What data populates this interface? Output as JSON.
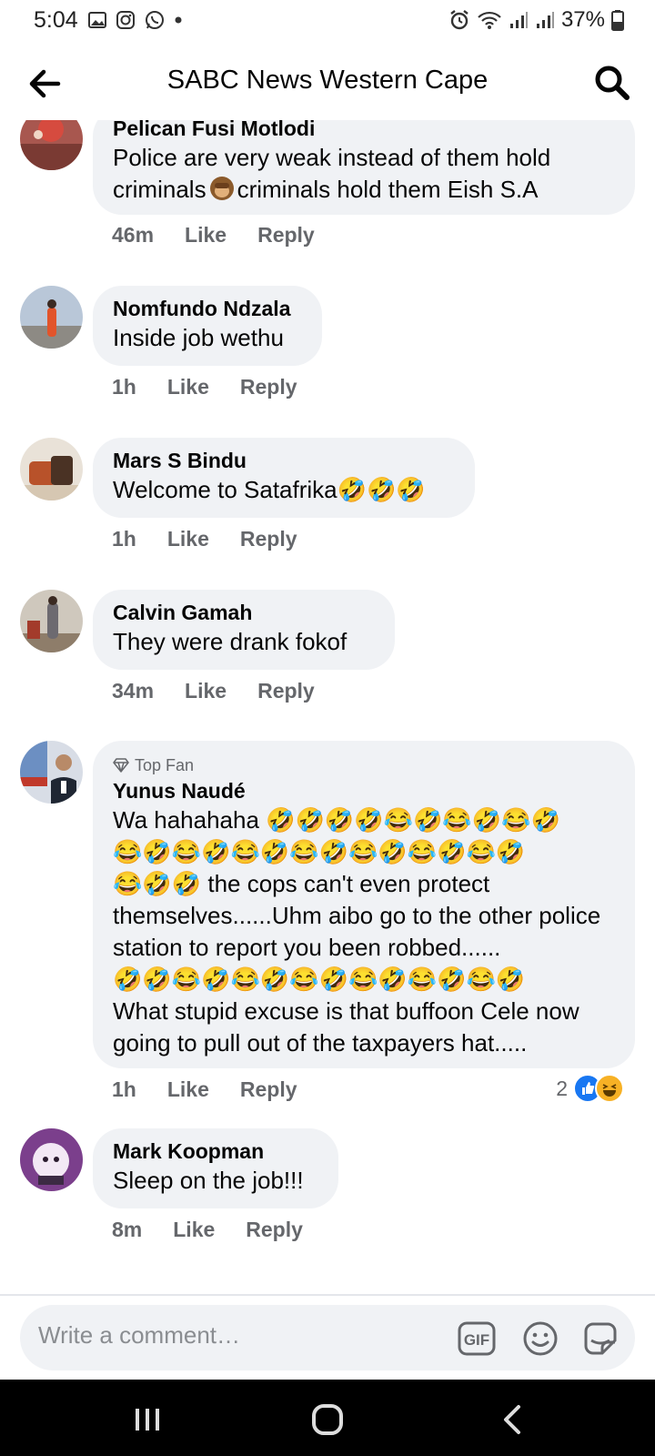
{
  "status": {
    "time": "5:04",
    "battery": "37%"
  },
  "header": {
    "title": "SABC News Western Cape"
  },
  "comments": [
    {
      "author": "Pelican Fusi Motlodi",
      "text_a": "Police are very weak instead of them hold criminals",
      "text_b": "criminals hold them Eish S.A",
      "time": "46m",
      "like": "Like",
      "reply": "Reply"
    },
    {
      "author": "Nomfundo Ndzala",
      "text": "Inside job wethu",
      "time": "1h",
      "like": "Like",
      "reply": "Reply"
    },
    {
      "author": "Mars S Bindu",
      "text": "Welcome to Satafrika",
      "emoji": "🤣🤣🤣",
      "time": "1h",
      "like": "Like",
      "reply": "Reply"
    },
    {
      "author": "Calvin Gamah",
      "text": "They were drank fokof",
      "time": "34m",
      "like": "Like",
      "reply": "Reply"
    },
    {
      "badge": "Top Fan",
      "author": "Yunus Naudé",
      "text_a": "Wa hahahaha ",
      "emoji_a": "🤣🤣🤣🤣😂🤣😂🤣😂🤣",
      "emoji_b": "😂🤣😂🤣😂🤣😂🤣😂🤣😂🤣😂🤣",
      "emoji_c": "😂🤣🤣",
      "text_b": " the cops can't even protect themselves......Uhm  aibo go to the other police station to report you been robbed......",
      "emoji_d": "🤣🤣😂🤣😂🤣😂🤣😂🤣😂🤣😂🤣",
      "text_c": "What stupid excuse is that buffoon Cele now going to pull out of the taxpayers hat.....",
      "time": "1h",
      "like": "Like",
      "reply": "Reply",
      "reaction_count": "2"
    },
    {
      "author": "Mark Koopman",
      "text": "Sleep on the job!!!",
      "time": "8m",
      "like": "Like",
      "reply": "Reply"
    }
  ],
  "composer": {
    "placeholder": "Write a comment…"
  },
  "colors": {
    "bubble": "#f0f2f5",
    "secondary_text": "#65676b",
    "like_blue": "#1877f2"
  }
}
